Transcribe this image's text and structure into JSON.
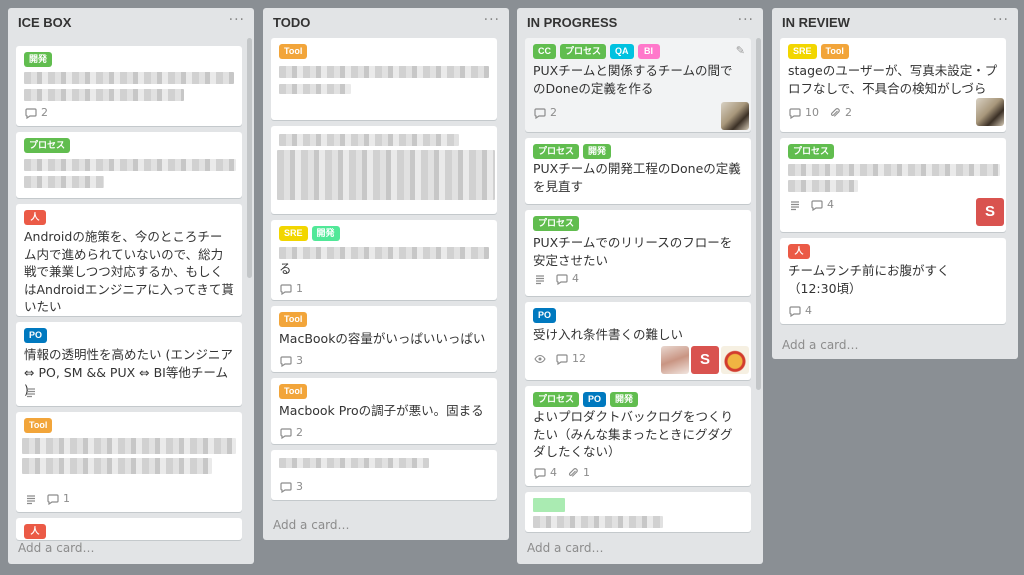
{
  "colors": {
    "background": "#8a8f94",
    "list_bg": "#e2e4e6",
    "label_green": "#61bd4f",
    "label_orange": "#f2a53a",
    "label_red": "#eb5a46",
    "label_blue": "#0079bf",
    "label_yellow": "#f2d600",
    "label_teal": "#51e898",
    "label_pink": "#ff78cb"
  },
  "add_card_label": "Add a card…",
  "list_menu_label": "···",
  "lists": [
    {
      "title": "ICE BOX",
      "cards": [
        {
          "labels": [
            {
              "text": "開発",
              "color": "#61bd4f"
            }
          ],
          "title": "",
          "badges": {
            "comments": "2"
          }
        },
        {
          "labels": [
            {
              "text": "プロセス",
              "color": "#61bd4f"
            }
          ],
          "title": "",
          "badges": {}
        },
        {
          "labels": [
            {
              "text": "人",
              "color": "#eb5a46"
            }
          ],
          "title": "Androidの施策を、今のところチーム内で進められていないので、総力戦で兼業しつつ対応するか、もしくはAndroidエンジニアに入ってきて貰いたい",
          "badges": {}
        },
        {
          "labels": [
            {
              "text": "PO",
              "color": "#0079bf"
            }
          ],
          "title": "情報の透明性を高めたい (エンジニア ⇔ PO, SM && PUX ⇔ BI等他チーム )",
          "badges": {
            "description": true
          }
        },
        {
          "labels": [
            {
              "text": "Tool",
              "color": "#f2a53a"
            }
          ],
          "title": "",
          "badges": {
            "description": true,
            "comments": "1"
          }
        },
        {
          "labels": [
            {
              "text": "人",
              "color": "#eb5a46"
            }
          ],
          "title": "",
          "badges": {}
        }
      ]
    },
    {
      "title": "TODO",
      "cards": [
        {
          "labels": [
            {
              "text": "Tool",
              "color": "#f2a53a"
            }
          ],
          "title": "",
          "badges": {}
        },
        {
          "labels": [],
          "title": "",
          "badges": {}
        },
        {
          "labels": [
            {
              "text": "SRE",
              "color": "#f2d600"
            },
            {
              "text": "開発",
              "color": "#51e898"
            }
          ],
          "title": "る",
          "badges": {
            "comments": "1"
          }
        },
        {
          "labels": [
            {
              "text": "Tool",
              "color": "#f2a53a"
            }
          ],
          "title": "MacBookの容量がいっぱいいっぱい",
          "badges": {
            "comments": "3"
          }
        },
        {
          "labels": [
            {
              "text": "Tool",
              "color": "#f2a53a"
            }
          ],
          "title": "Macbook Proの調子が悪い。固まる",
          "badges": {
            "comments": "2"
          }
        },
        {
          "labels": [],
          "title": "",
          "badges": {
            "comments": "3"
          }
        }
      ]
    },
    {
      "title": "IN PROGRESS",
      "cards": [
        {
          "labels": [
            {
              "text": "CC",
              "color": "#61bd4f"
            },
            {
              "text": "プロセス",
              "color": "#61bd4f"
            },
            {
              "text": "QA",
              "color": "#00c2e0"
            },
            {
              "text": "BI",
              "color": "#ff78cb"
            }
          ],
          "title": "PUXチームと関係するチームの間でのDoneの定義を作る",
          "badges": {
            "comments": "2"
          }
        },
        {
          "labels": [
            {
              "text": "プロセス",
              "color": "#61bd4f"
            },
            {
              "text": "開発",
              "color": "#61bd4f"
            }
          ],
          "title": "PUXチームの開発工程のDoneの定義を見直す",
          "badges": {}
        },
        {
          "labels": [
            {
              "text": "プロセス",
              "color": "#61bd4f"
            }
          ],
          "title": "PUXチームでのリリースのフローを安定させたい",
          "badges": {
            "description": true,
            "comments": "4"
          }
        },
        {
          "labels": [
            {
              "text": "PO",
              "color": "#0079bf"
            }
          ],
          "title": "受け入れ条件書くの難しい",
          "badges": {
            "watch": true,
            "comments": "12"
          }
        },
        {
          "labels": [
            {
              "text": "プロセス",
              "color": "#61bd4f"
            },
            {
              "text": "PO",
              "color": "#0079bf"
            },
            {
              "text": "開発",
              "color": "#61bd4f"
            }
          ],
          "title": "よいプロダクトバックログをつくりたい（みんな集まったときにグダグダしたくない）",
          "badges": {
            "comments": "4",
            "attachments": "1"
          }
        },
        {
          "labels": [],
          "title": "",
          "badges": {}
        }
      ]
    },
    {
      "title": "IN REVIEW",
      "cards": [
        {
          "labels": [
            {
              "text": "SRE",
              "color": "#f2d600"
            },
            {
              "text": "Tool",
              "color": "#f2a53a"
            }
          ],
          "title": "stageのユーザーが、写真未設定・プロフなしで、不具合の検知がしづらい",
          "badges": {
            "comments": "10",
            "attachments": "2"
          }
        },
        {
          "labels": [
            {
              "text": "プロセス",
              "color": "#61bd4f"
            }
          ],
          "title": "",
          "badges": {
            "description": true,
            "comments": "4"
          }
        },
        {
          "labels": [
            {
              "text": "人",
              "color": "#eb5a46"
            }
          ],
          "title": "チームランチ前にお腹がすく（12:30頃）",
          "badges": {
            "comments": "4"
          }
        }
      ]
    }
  ],
  "avatars": {
    "s_letter": "S"
  }
}
